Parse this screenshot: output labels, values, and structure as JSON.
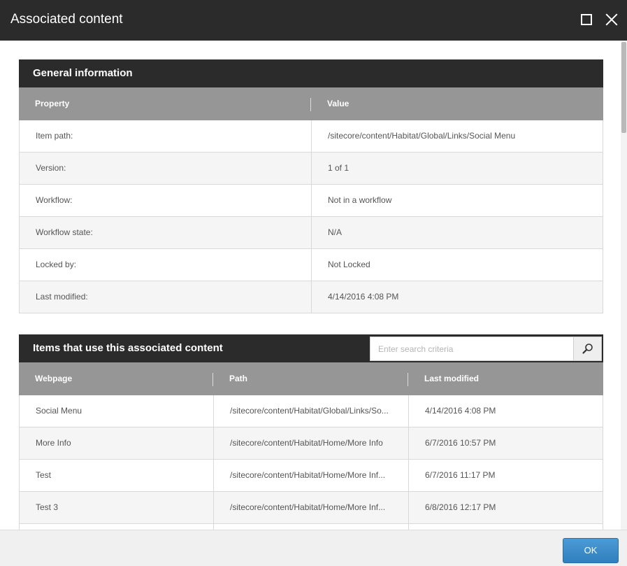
{
  "window": {
    "title": "Associated content",
    "maximize_icon": "maximize-icon",
    "close_icon": "close-icon"
  },
  "general": {
    "title": "General information",
    "columns": [
      "Property",
      "Value"
    ],
    "rows": [
      {
        "property": "Item path:",
        "value": "/sitecore/content/Habitat/Global/Links/Social Menu"
      },
      {
        "property": "Version:",
        "value": "1 of 1"
      },
      {
        "property": "Workflow:",
        "value": "Not in a workflow"
      },
      {
        "property": "Workflow state:",
        "value": "N/A"
      },
      {
        "property": "Locked by:",
        "value": "Not Locked"
      },
      {
        "property": "Last modified:",
        "value": "4/14/2016 4:08 PM"
      }
    ]
  },
  "items": {
    "title": "Items that use this associated content",
    "search": {
      "placeholder": "Enter search criteria",
      "value": "",
      "icon": "search-icon"
    },
    "columns": [
      "Webpage",
      "Path",
      "Last modified"
    ],
    "rows": [
      {
        "webpage": "Social Menu",
        "path": "/sitecore/content/Habitat/Global/Links/So...",
        "modified": "4/14/2016 4:08 PM"
      },
      {
        "webpage": "More Info",
        "path": "/sitecore/content/Habitat/Home/More Info",
        "modified": "6/7/2016 10:57 PM"
      },
      {
        "webpage": "Test",
        "path": "/sitecore/content/Habitat/Home/More Inf...",
        "modified": "6/7/2016 11:17 PM"
      },
      {
        "webpage": "Test 3",
        "path": "/sitecore/content/Habitat/Home/More Inf...",
        "modified": "6/8/2016 12:17 PM"
      },
      {
        "webpage": "",
        "path": "",
        "modified": ""
      }
    ]
  },
  "footer": {
    "ok_label": "OK"
  },
  "colors": {
    "header_dark": "#2b2b2b",
    "column_header": "#969696",
    "ok_button": "#2f7fbf"
  }
}
